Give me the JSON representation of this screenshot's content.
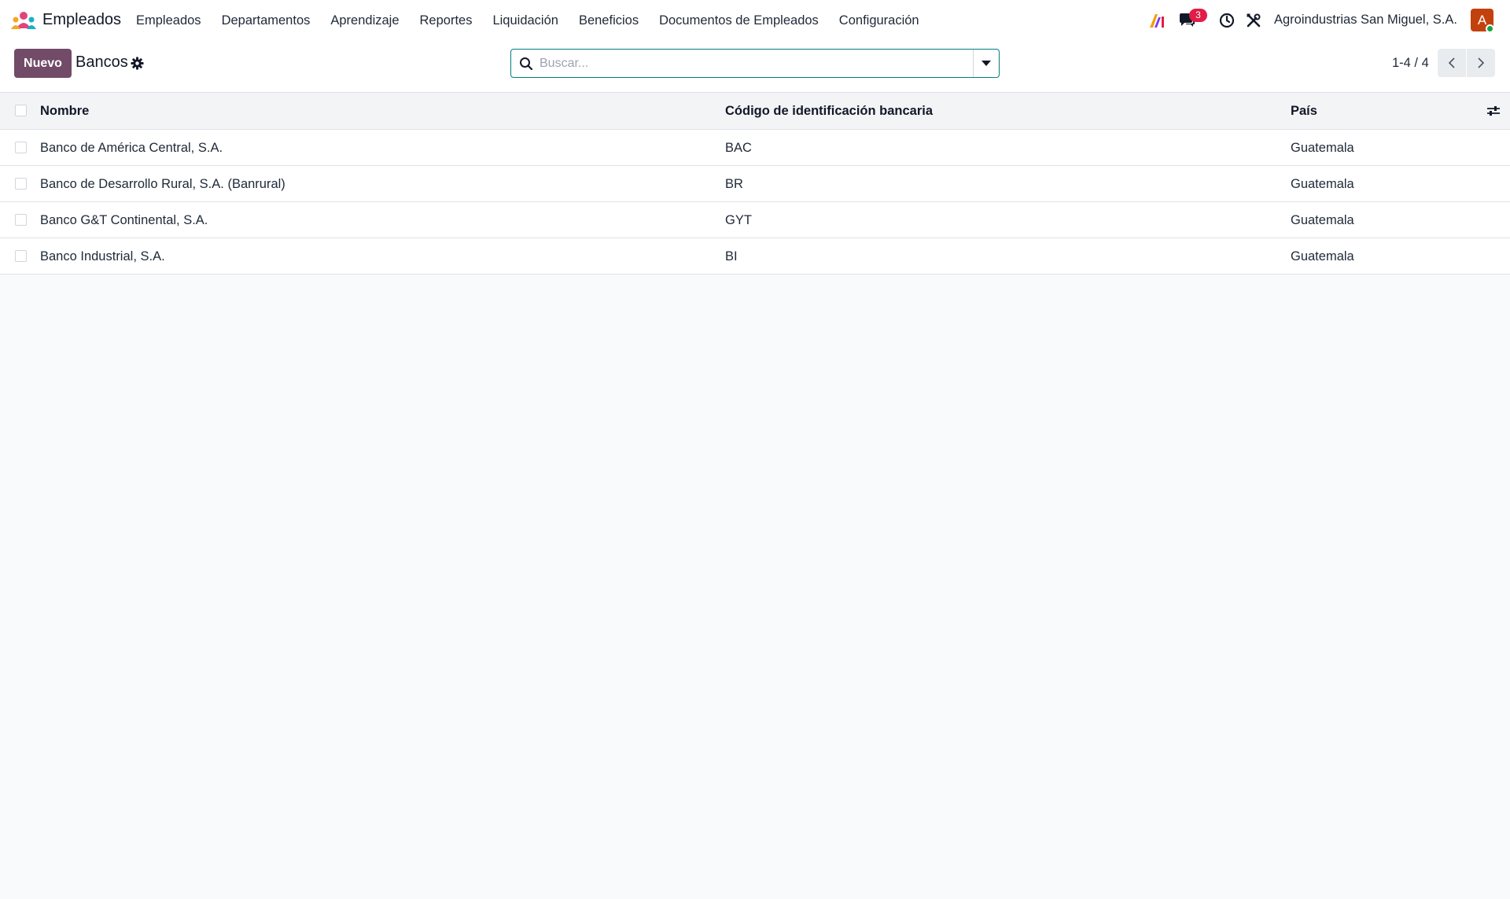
{
  "navbar": {
    "app_name": "Empleados",
    "menu": [
      "Empleados",
      "Departamentos",
      "Aprendizaje",
      "Reportes",
      "Liquidación",
      "Beneficios",
      "Documentos de Empleados",
      "Configuración"
    ],
    "chat_badge": "3",
    "company": "Agroindustrias San Miguel, S.A.",
    "avatar_initial": "A",
    "icons": [
      "employees-app-icon",
      "ai-icon",
      "chat-icon",
      "clock-icon",
      "tools-icon"
    ]
  },
  "control": {
    "new_label": "Nuevo",
    "breadcrumb": "Bancos",
    "search_placeholder": "Buscar...",
    "pager": "1-4 / 4"
  },
  "table": {
    "columns": [
      "Nombre",
      "Código de identificación bancaria",
      "País"
    ],
    "rows": [
      [
        "Banco de América Central, S.A.",
        "BAC",
        "Guatemala"
      ],
      [
        "Banco de Desarrollo Rural, S.A. (Banrural)",
        "BR",
        "Guatemala"
      ],
      [
        "Banco G&T Continental, S.A.",
        "GYT",
        "Guatemala"
      ],
      [
        "Banco Industrial, S.A.",
        "BI",
        "Guatemala"
      ]
    ]
  },
  "colors": {
    "brand": "#714b67",
    "search_border": "#017e84",
    "badge": "#e11d48",
    "avatar": "#c2410c"
  }
}
